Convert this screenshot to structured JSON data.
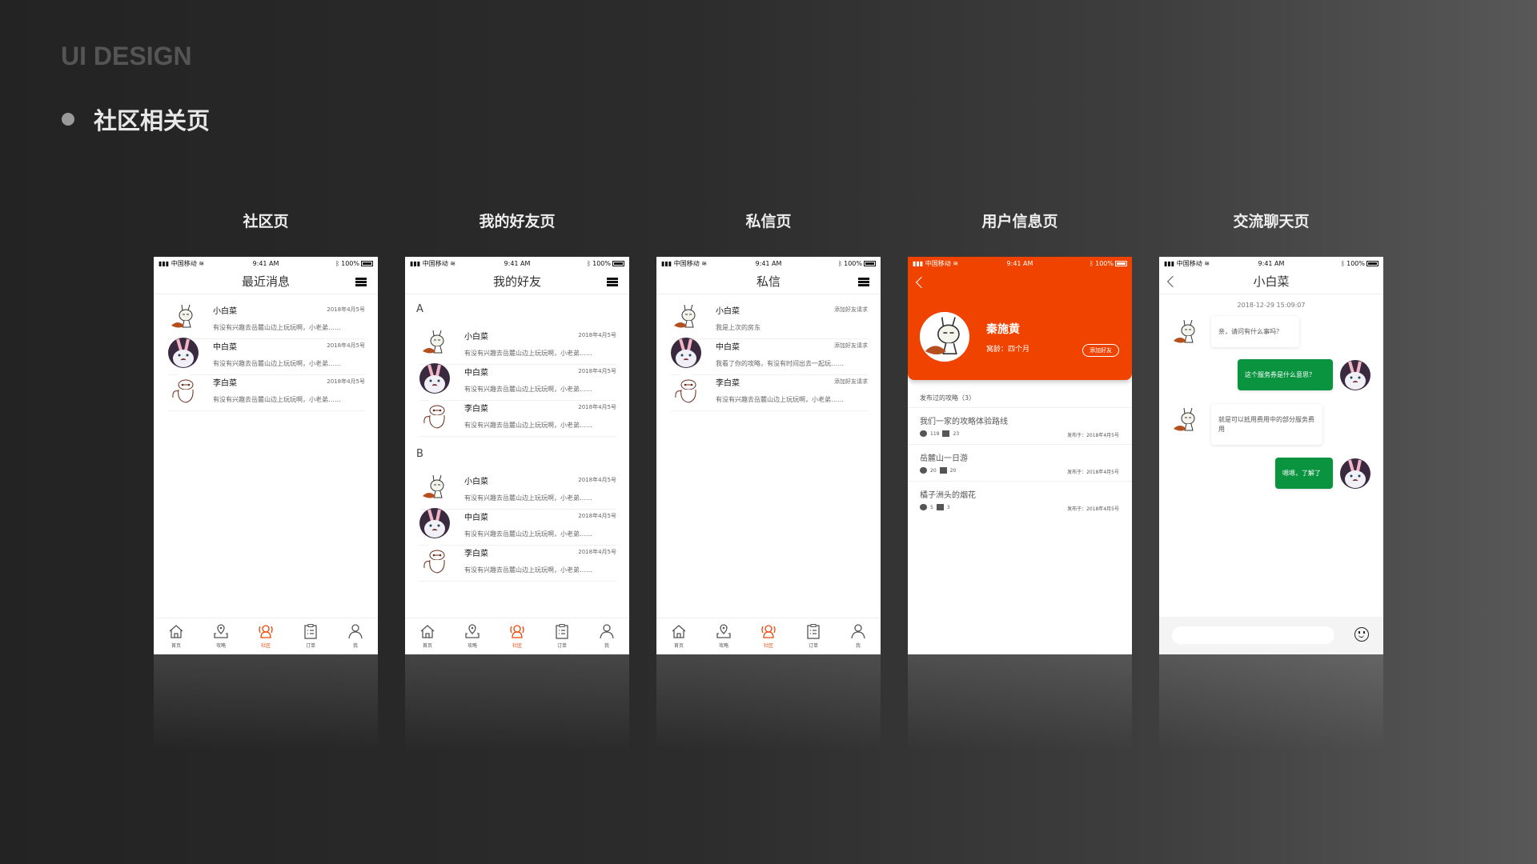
{
  "brand": "UI DESIGN",
  "section_title": "社区相关页",
  "colors": {
    "accent": "#f04300",
    "chat_green": "#0a9440"
  },
  "status": {
    "carrier": "中国移动",
    "time": "9:41 AM",
    "battery": "100%"
  },
  "tabs": [
    {
      "label": "首页",
      "icon": "home-icon"
    },
    {
      "label": "攻略",
      "icon": "map-pin-icon"
    },
    {
      "label": "社区",
      "icon": "community-icon",
      "active": true
    },
    {
      "label": "订单",
      "icon": "clipboard-icon"
    },
    {
      "label": "我",
      "icon": "user-icon"
    }
  ],
  "pages": {
    "community": {
      "label": "社区页",
      "title": "最近消息",
      "rows": [
        {
          "name": "小白菜",
          "date": "2018年4月5号",
          "msg": "有没有兴趣去岳麓山边上玩玩啊，小老弟……",
          "avatar": "rabbit-sketch"
        },
        {
          "name": "中白菜",
          "date": "2018年4月5号",
          "msg": "有没有兴趣去岳麓山边上玩玩啊，小老弟……",
          "avatar": "snowball-bunny"
        },
        {
          "name": "李白菜",
          "date": "2018年4月5号",
          "msg": "有没有兴趣去岳麓山边上玩玩啊，小老弟……",
          "avatar": "baymax-sketch"
        }
      ]
    },
    "friends": {
      "label": "我的好友页",
      "title": "我的好友",
      "groups": [
        {
          "letter": "A",
          "rows": [
            {
              "name": "小白菜",
              "date": "2018年4月5号",
              "msg": "有没有兴趣去岳麓山边上玩玩啊，小老弟……",
              "avatar": "rabbit-sketch"
            },
            {
              "name": "中白菜",
              "date": "2018年4月5号",
              "msg": "有没有兴趣去岳麓山边上玩玩啊，小老弟……",
              "avatar": "snowball-bunny"
            },
            {
              "name": "李白菜",
              "date": "2018年4月5号",
              "msg": "有没有兴趣去岳麓山边上玩玩啊，小老弟……",
              "avatar": "baymax-sketch"
            }
          ]
        },
        {
          "letter": "B",
          "rows": [
            {
              "name": "小白菜",
              "date": "2018年4月5号",
              "msg": "有没有兴趣去岳麓山边上玩玩啊，小老弟……",
              "avatar": "rabbit-sketch"
            },
            {
              "name": "中白菜",
              "date": "2018年4月5号",
              "msg": "有没有兴趣去岳麓山边上玩玩啊，小老弟……",
              "avatar": "snowball-bunny"
            },
            {
              "name": "李白菜",
              "date": "2018年4月5号",
              "msg": "有没有兴趣去岳麓山边上玩玩啊，小老弟……",
              "avatar": "baymax-sketch"
            }
          ]
        }
      ]
    },
    "messages": {
      "label": "私信页",
      "title": "私信",
      "rows": [
        {
          "name": "小白菜",
          "date": "添加好友请求",
          "msg": "我是上次的房东",
          "avatar": "rabbit-sketch"
        },
        {
          "name": "中白菜",
          "date": "添加好友请求",
          "msg": "我看了你的攻略，有没有时间出去一起玩……",
          "avatar": "snowball-bunny"
        },
        {
          "name": "李白菜",
          "date": "添加好友请求",
          "msg": "有没有兴趣去岳麓山边上玩玩啊，小老弟……",
          "avatar": "baymax-sketch"
        }
      ]
    },
    "profile": {
      "label": "用户信息页",
      "name": "秦施黄",
      "age": "窝龄：四个月",
      "add_friend": "添加好友",
      "posts_header": "发布过的攻略（3）",
      "posts": [
        {
          "title": "我们一家的攻略体验路线",
          "likes": "119",
          "comments": "23",
          "date": "发布于：2018年4月5号"
        },
        {
          "title": "岳麓山一日游",
          "likes": "20",
          "comments": "20",
          "date": "发布于：2018年4月5号"
        },
        {
          "title": "橘子洲头的烟花",
          "likes": "5",
          "comments": "3",
          "date": "发布于：2018年4月5号"
        }
      ]
    },
    "chat": {
      "label": "交流聊天页",
      "title": "小白菜",
      "timestamp": "2018-12-29  15:09:07",
      "input_placeholder": "",
      "messages": [
        {
          "side": "l",
          "text": "亲，请问有什么事吗？"
        },
        {
          "side": "r",
          "text": "这个服务券是什么意思？"
        },
        {
          "side": "l",
          "text": "就是可以抵用费用中的部分服务费用"
        },
        {
          "side": "r",
          "text": "嗯嗯，了解了"
        }
      ]
    }
  }
}
